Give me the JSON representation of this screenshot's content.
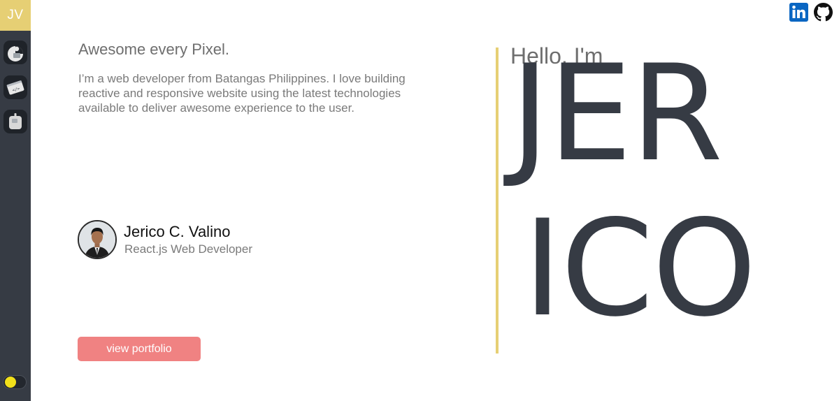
{
  "sidebar": {
    "logo": "JV",
    "nav": [
      {
        "icon": "home-icon"
      },
      {
        "icon": "projects-icon"
      },
      {
        "icon": "contact-icon"
      }
    ],
    "theme_toggle": {
      "icon": "theme-toggle",
      "accent": "#f2e01a"
    }
  },
  "social": [
    {
      "icon": "linkedin-icon",
      "color": "#0a66c2"
    },
    {
      "icon": "github-icon",
      "color": "#111111"
    }
  ],
  "hero": {
    "headline": "Awesome every Pixel.",
    "intro": "I’m a web developer from Batangas Philippines. I love building reactive and responsive website using the latest technologies available to deliver awesome experience to the user.",
    "profile": {
      "name": "Jerico C. Valino",
      "role": "React.js Web Developer"
    },
    "cta_label": "view portfolio"
  },
  "greeting": {
    "lead": "Hello, I'm",
    "name_line_1": "JER",
    "name_line_2": "ICO"
  },
  "colors": {
    "accent": "#e6cf74",
    "sidebar": "#363b44",
    "cta": "#f08282"
  }
}
